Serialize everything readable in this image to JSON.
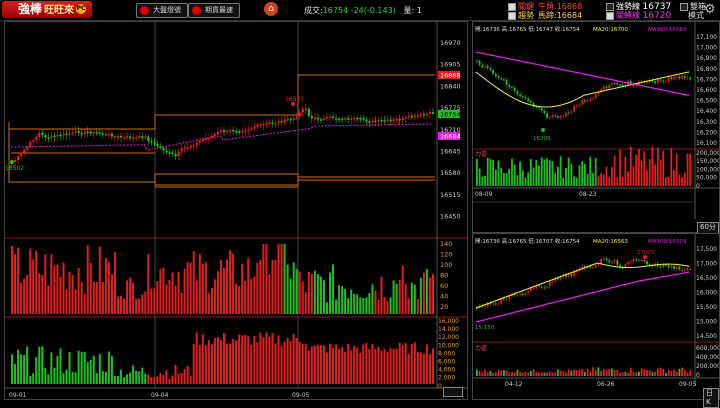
{
  "app": {
    "logo_main": "強棒",
    "logo_sub": "旺旺來",
    "logo_badge": "PC"
  },
  "toolbar": {
    "btn_market": "大盤燈號",
    "btn_futures": "期貨最速",
    "home_icon": "home-icon"
  },
  "quote": {
    "label": "成交:",
    "price": "16754",
    "change": "-24(-0.143)",
    "volume_label": "量:",
    "volume": "1"
  },
  "indicators": {
    "key_label": "關鍵",
    "key_sub": "趨勢",
    "resist_label": "牛角:",
    "resist_value": "16868",
    "wave_label": "馬蹄:",
    "wave_value": "16684",
    "strong_label": "強勢線",
    "strong_value": "16737",
    "weak_label": "關轉線",
    "weak_value": "16720",
    "dual_label": "雙箱",
    "dual_sub": "模式"
  },
  "main_chart": {
    "price_ticks": [
      "16970",
      "16905",
      "16840",
      "16775",
      "16710",
      "16645",
      "16580",
      "16515",
      "16450"
    ],
    "price_tag_high": "16868",
    "price_tag_cur": "16754",
    "price_tag_low": "16684",
    "low_label": "16502",
    "high_label": "16811",
    "volume_ticks": [
      "140",
      "120",
      "100",
      "80",
      "60",
      "40",
      "20"
    ],
    "osc_ticks": [
      "16,000",
      "14,000",
      "12,000",
      "10,000",
      "8,000",
      "6,000",
      "4,000",
      "2,000",
      "0"
    ],
    "dates": [
      "09-01",
      "09-04",
      "09-05"
    ],
    "bottom_btn": ""
  },
  "right_top": {
    "header": "開:16736 高:16765 低:16747 收:16754",
    "ma20": "MA20:16700",
    "ma100": "MA100:16563",
    "price_ticks": [
      "17,100",
      "17,000",
      "16,900",
      "16,800",
      "16,700",
      "16,600",
      "16,500",
      "16,400",
      "16,300",
      "16,200",
      "16,100"
    ],
    "low_label": "16205",
    "sub_label": "力道",
    "vol_ticks": [
      "200,000",
      "150,000",
      "100,000",
      "50,000",
      "0"
    ],
    "dates": [
      "08-09",
      "08-23"
    ],
    "tf_btn": "60分K"
  },
  "right_bottom": {
    "header": "開:16736 高:16765 低:16707 收:16754",
    "ma20": "MA20:16563",
    "ma100": "MA100:16509",
    "price_ticks": [
      "17,500",
      "17,000",
      "16,500",
      "16,000",
      "15,500",
      "15,000",
      "14,500"
    ],
    "high_label": "17025",
    "low_label": "15,150",
    "sub_label": "力道",
    "vol_ticks": [
      "600,000",
      "400,000",
      "200,000",
      "0"
    ],
    "dates": [
      "04-12",
      "06-26",
      "09-05"
    ],
    "tf_btn": "日K"
  },
  "colors": {
    "up": "#e02020",
    "down": "#20c020",
    "ma_yellow": "#f0f040",
    "ma_magenta": "#e020e0",
    "box_orange": "#d07010"
  }
}
